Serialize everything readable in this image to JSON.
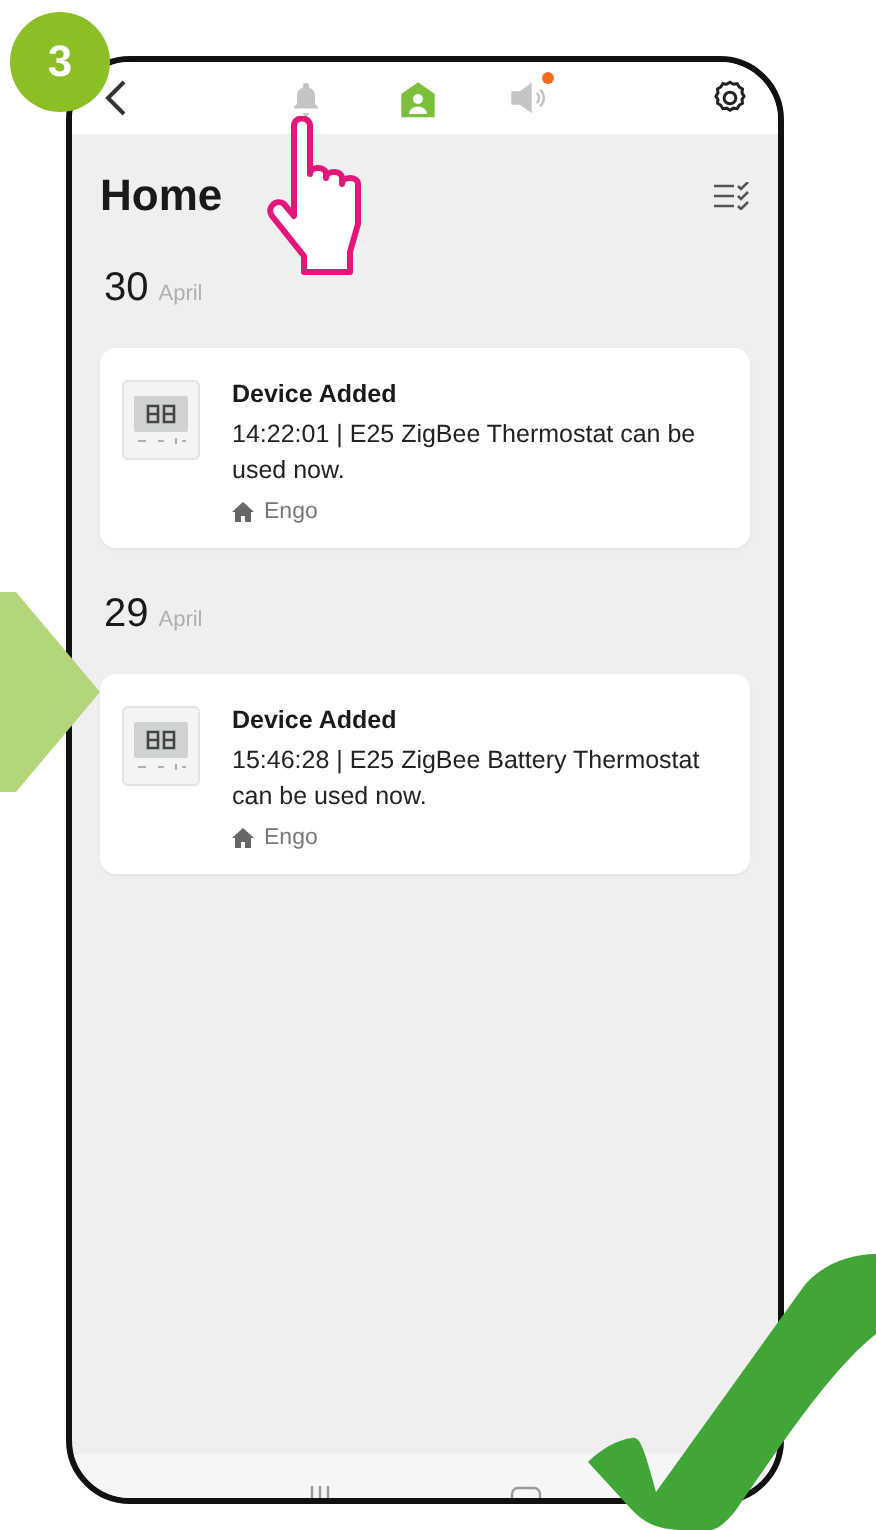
{
  "annotation": {
    "step": "3"
  },
  "top_bar": {
    "tabs": [
      {
        "kind": "bell",
        "selected": false,
        "badge": false
      },
      {
        "kind": "home",
        "selected": true,
        "badge": false
      },
      {
        "kind": "speaker",
        "selected": false,
        "badge": true
      }
    ]
  },
  "header": {
    "title": "Home"
  },
  "groups": [
    {
      "day": "30",
      "month": "April",
      "messages": [
        {
          "title": "Device Added",
          "text": "14:22:01 | E25 ZigBee Thermostat can be used now.",
          "home": "Engo"
        }
      ]
    },
    {
      "day": "29",
      "month": "April",
      "messages": [
        {
          "title": "Device Added",
          "text": "15:46:28 | E25 ZigBee Battery Thermostat can be used now.",
          "home": "Engo"
        }
      ]
    }
  ]
}
